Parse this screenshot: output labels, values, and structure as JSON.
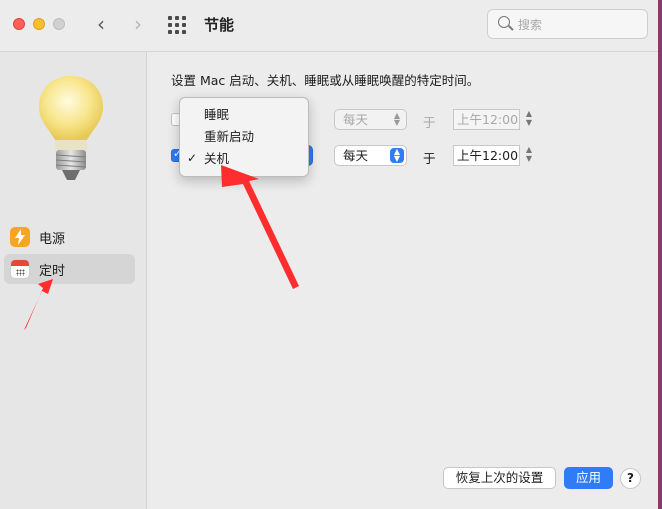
{
  "window": {
    "title": "节能",
    "search_placeholder": "搜索"
  },
  "sidebar": {
    "items": [
      {
        "label": "电源",
        "icon": "power-bolt-icon",
        "selected": false
      },
      {
        "label": "定时",
        "icon": "calendar-icon",
        "selected": true
      }
    ]
  },
  "main": {
    "description": "设置 Mac 启动、关机、睡眠或从睡眠唤醒的特定时间。",
    "rows": [
      {
        "checked": false,
        "day": "每天",
        "at": "于",
        "time": "上午12:00",
        "enabled": false
      },
      {
        "checked": true,
        "day": "每天",
        "at": "于",
        "time": "上午12:00",
        "enabled": true
      }
    ],
    "action_menu": {
      "items": [
        {
          "label": "睡眠",
          "checked": false
        },
        {
          "label": "重新启动",
          "checked": false
        },
        {
          "label": "关机",
          "checked": true
        }
      ],
      "check_glyph": "✓"
    }
  },
  "footer": {
    "restore_label": "恢复上次的设置",
    "apply_label": "应用",
    "help_label": "?"
  },
  "colors": {
    "accent": "#2f7cf6",
    "annotation_arrow": "#ff2d2d"
  }
}
